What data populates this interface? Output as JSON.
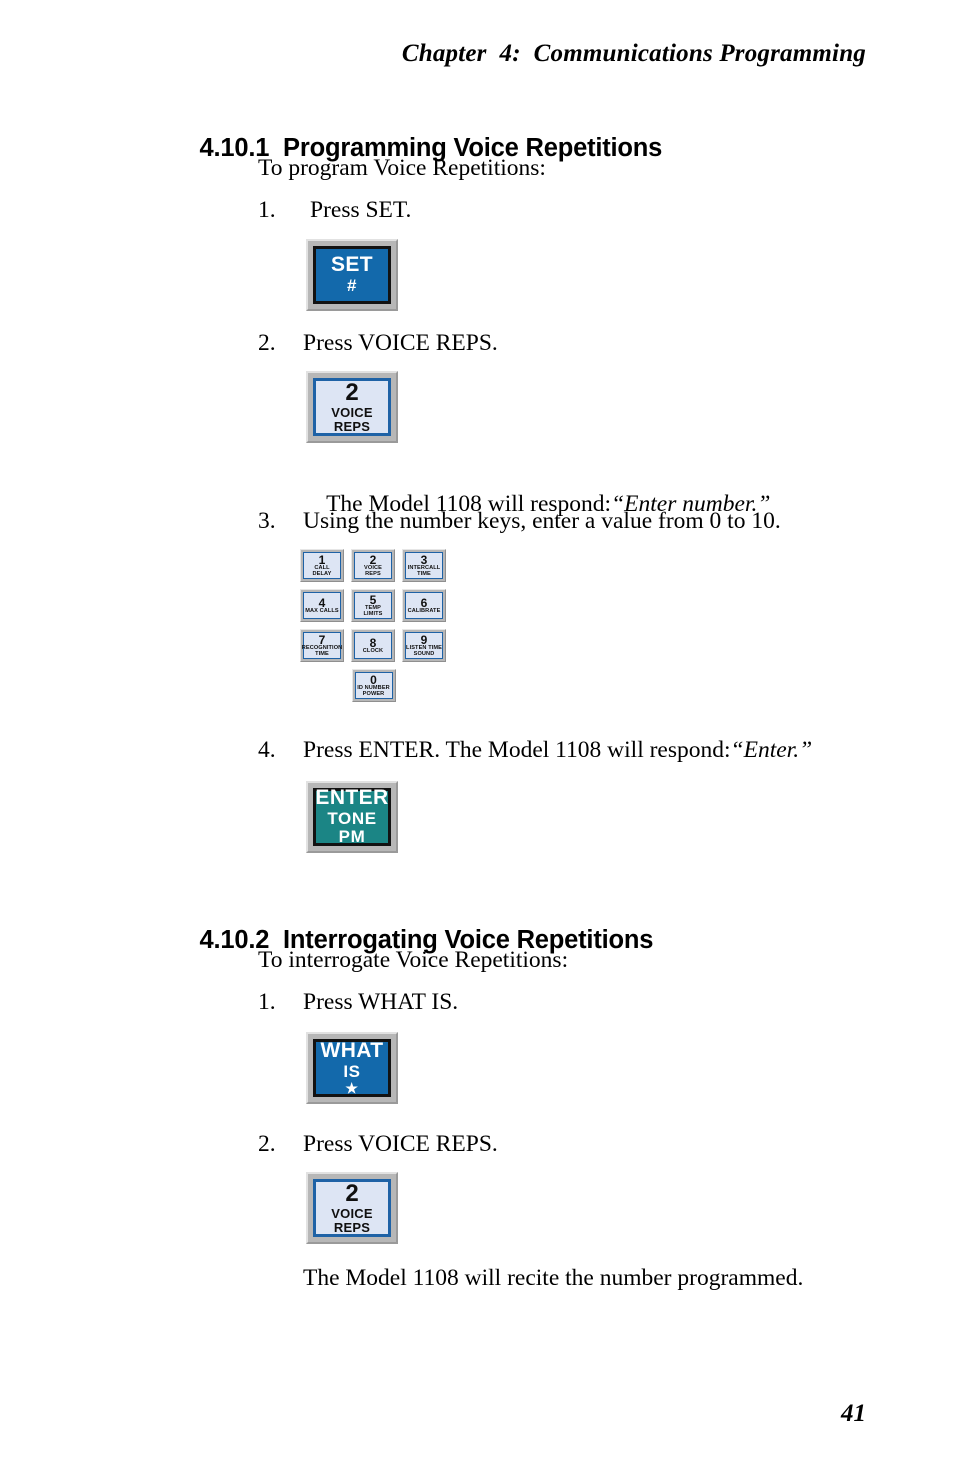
{
  "page": {
    "running_head": "Chapter  4:  Communications Programming",
    "folio": "41"
  },
  "sections": [
    {
      "number": "4.10.1",
      "title": "Programming Voice Repetitions",
      "intro": "To program Voice Repetitions:",
      "steps": [
        {
          "mark": "1.",
          "text": "Press SET."
        },
        {
          "mark": "2.",
          "text": "Press VOICE REPS."
        },
        {
          "mark": "3.",
          "text": "Using the number keys, enter a value from 0 to 10."
        },
        {
          "mark": "4.",
          "text": "Press ENTER. The Model 1108 will respond:",
          "quote": "“Enter.”"
        }
      ],
      "respond_line": {
        "lead": "The Model 1108 will respond:",
        "quote": "“Enter number.”"
      }
    },
    {
      "number": "4.10.2",
      "title": "Interrogating Voice Repetitions",
      "intro": "To interrogate Voice Repetitions:",
      "steps": [
        {
          "mark": "1.",
          "text": "Press WHAT IS."
        },
        {
          "mark": "2.",
          "text": "Press VOICE REPS."
        }
      ],
      "closing": "The Model 1108 will recite the number programmed."
    }
  ],
  "keys": {
    "set": {
      "l1": "SET",
      "l2": "#",
      "l3": "",
      "color": "#1369ab"
    },
    "enter": {
      "l1": "ENTER",
      "l2": "TONE",
      "l3": "PM",
      "color": "#1b8585"
    },
    "what": {
      "l1": "WHAT",
      "l2": "IS",
      "l3": "★",
      "color": "#1369ab"
    },
    "voice_reps_1": {
      "l1": "2",
      "l2": "VOICE",
      "l3": "REPS"
    },
    "voice_reps_2": {
      "l1": "2",
      "l2": "VOICE",
      "l3": "REPS"
    }
  },
  "keypad": {
    "rows": [
      [
        {
          "digit": "1",
          "line2": "CALL",
          "line3": "DELAY"
        },
        {
          "digit": "2",
          "line2": "VOICE",
          "line3": "REPS"
        },
        {
          "digit": "3",
          "line2": "INTERCALL",
          "line3": "TIME"
        }
      ],
      [
        {
          "digit": "4",
          "line2": "MAX CALLS",
          "line3": ""
        },
        {
          "digit": "5",
          "line2": "TEMP LIMITS",
          "line3": ""
        },
        {
          "digit": "6",
          "line2": "CALIBRATE",
          "line3": ""
        }
      ],
      [
        {
          "digit": "7",
          "line2": "RECOGNITION",
          "line3": "TIME"
        },
        {
          "digit": "8",
          "line2": "CLOCK",
          "line3": ""
        },
        {
          "digit": "9",
          "line2": "LISTEN TIME",
          "line3": "SOUND"
        }
      ],
      [
        {
          "digit": "0",
          "line2": "ID NUMBER",
          "line3": "POWER"
        }
      ]
    ]
  }
}
